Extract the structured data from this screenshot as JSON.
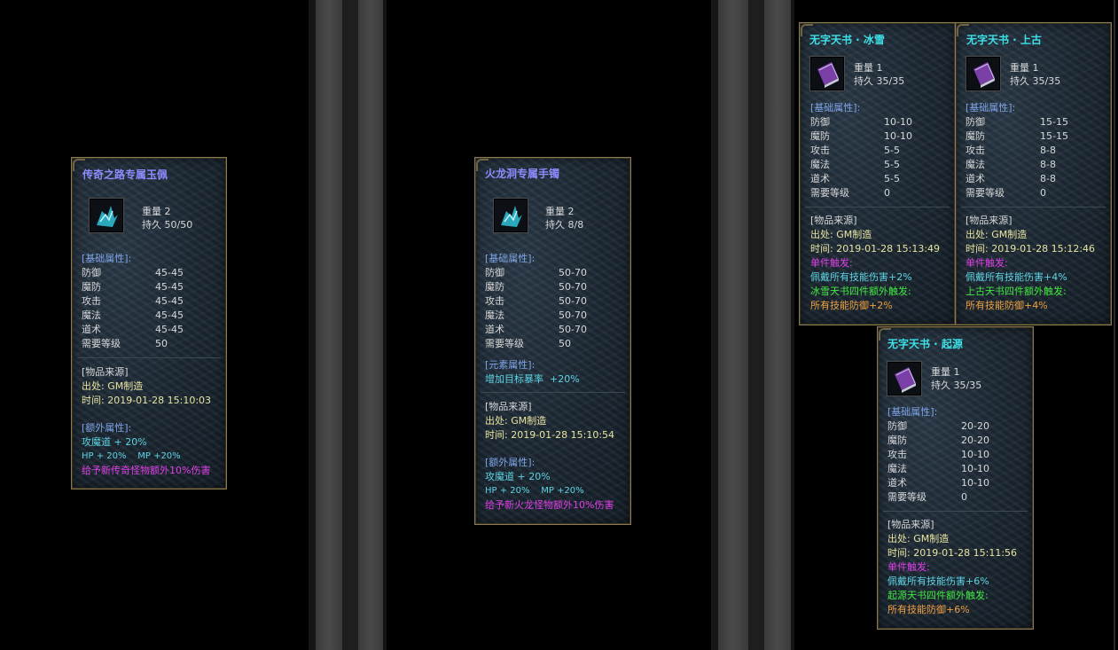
{
  "colors": {
    "title_blue": "#8e8cff",
    "title_cyan": "#3ee0e8",
    "section": "#7ea4e8",
    "source_text": "#e8e4a0",
    "extra_cyan": "#5ed4e4",
    "magenta": "#e040e8",
    "green": "#42e842",
    "orange": "#f0a040",
    "card_border": "#8a7a52"
  },
  "card1": {
    "title": "传奇之路专属玉佩",
    "icon": "jade-pendant-icon",
    "weight": "重量 2",
    "durability": "持久 50/50",
    "base_header": "[基础属性]:",
    "stats": [
      {
        "label": "防御",
        "value": "45-45"
      },
      {
        "label": "魔防",
        "value": "45-45"
      },
      {
        "label": "攻击",
        "value": "45-45"
      },
      {
        "label": "魔法",
        "value": "45-45"
      },
      {
        "label": "道术",
        "value": "45-45"
      },
      {
        "label": "需要等级",
        "value": "50"
      }
    ],
    "source_header": "[物品来源]",
    "origin": "出处: GM制造",
    "time": "时间: 2019-01-28 15:10:03",
    "extra_header": "[额外属性]:",
    "extra1": "攻魔道 + 20%",
    "extra2": "HP + 20%    MP +20%",
    "extra3": "给予新传奇怪物额外10%伤害"
  },
  "card2": {
    "title": "火龙洞专属手镯",
    "icon": "bracelet-icon",
    "weight": "重量 2",
    "durability": "持久 8/8",
    "base_header": "[基础属性]:",
    "stats": [
      {
        "label": "防御",
        "value": "50-70"
      },
      {
        "label": "魔防",
        "value": "50-70"
      },
      {
        "label": "攻击",
        "value": "50-70"
      },
      {
        "label": "魔法",
        "value": "50-70"
      },
      {
        "label": "道术",
        "value": "50-70"
      },
      {
        "label": "需要等级",
        "value": "50"
      }
    ],
    "element_header": "[元素属性]:",
    "element1": "增加目标暴率  +20%",
    "source_header": "[物品来源]",
    "origin": "出处: GM制造",
    "time": "时间: 2019-01-28 15:10:54",
    "extra_header": "[额外属性]:",
    "extra1": "攻魔道 + 20%",
    "extra2": "HP + 20%    MP +20%",
    "extra3": "给予新火龙怪物额外10%伤害"
  },
  "card3": {
    "title": "无字天书 · 冰雪",
    "icon": "skill-book-icon",
    "weight": "重量 1",
    "durability": "持久 35/35",
    "base_header": "[基础属性]:",
    "stats": [
      {
        "label": "防御",
        "value": "10-10"
      },
      {
        "label": "魔防",
        "value": "10-10"
      },
      {
        "label": "攻击",
        "value": "5-5"
      },
      {
        "label": "魔法",
        "value": "5-5"
      },
      {
        "label": "道术",
        "value": "5-5"
      },
      {
        "label": "需要等级",
        "value": "0"
      }
    ],
    "source_header": "[物品来源]",
    "origin": "出处: GM制造",
    "time": "时间: 2019-01-28 15:13:49",
    "trigger_header": "单件触发:",
    "trigger1": "佩戴所有技能伤害+2%",
    "set_header": "冰雪天书四件额外触发:",
    "set1": "所有技能防御+2%"
  },
  "card4": {
    "title": "无字天书 · 上古",
    "icon": "skill-book-icon",
    "weight": "重量 1",
    "durability": "持久 35/35",
    "base_header": "[基础属性]:",
    "stats": [
      {
        "label": "防御",
        "value": "15-15"
      },
      {
        "label": "魔防",
        "value": "15-15"
      },
      {
        "label": "攻击",
        "value": "8-8"
      },
      {
        "label": "魔法",
        "value": "8-8"
      },
      {
        "label": "道术",
        "value": "8-8"
      },
      {
        "label": "需要等级",
        "value": "0"
      }
    ],
    "source_header": "[物品来源]",
    "origin": "出处: GM制造",
    "time": "时间: 2019-01-28 15:12:46",
    "trigger_header": "单件触发:",
    "trigger1": "佩戴所有技能伤害+4%",
    "set_header": "上古天书四件额外触发:",
    "set1": "所有技能防御+4%"
  },
  "card5": {
    "title": "无字天书 · 起源",
    "icon": "skill-book-icon",
    "weight": "重量 1",
    "durability": "持久 35/35",
    "base_header": "[基础属性]:",
    "stats": [
      {
        "label": "防御",
        "value": "20-20"
      },
      {
        "label": "魔防",
        "value": "20-20"
      },
      {
        "label": "攻击",
        "value": "10-10"
      },
      {
        "label": "魔法",
        "value": "10-10"
      },
      {
        "label": "道术",
        "value": "10-10"
      },
      {
        "label": "需要等级",
        "value": "0"
      }
    ],
    "source_header": "[物品来源]",
    "origin": "出处: GM制造",
    "time": "时间: 2019-01-28 15:11:56",
    "trigger_header": "单件触发:",
    "trigger1": "佩戴所有技能伤害+6%",
    "set_header": "起源天书四件额外触发:",
    "set1": "所有技能防御+6%"
  }
}
